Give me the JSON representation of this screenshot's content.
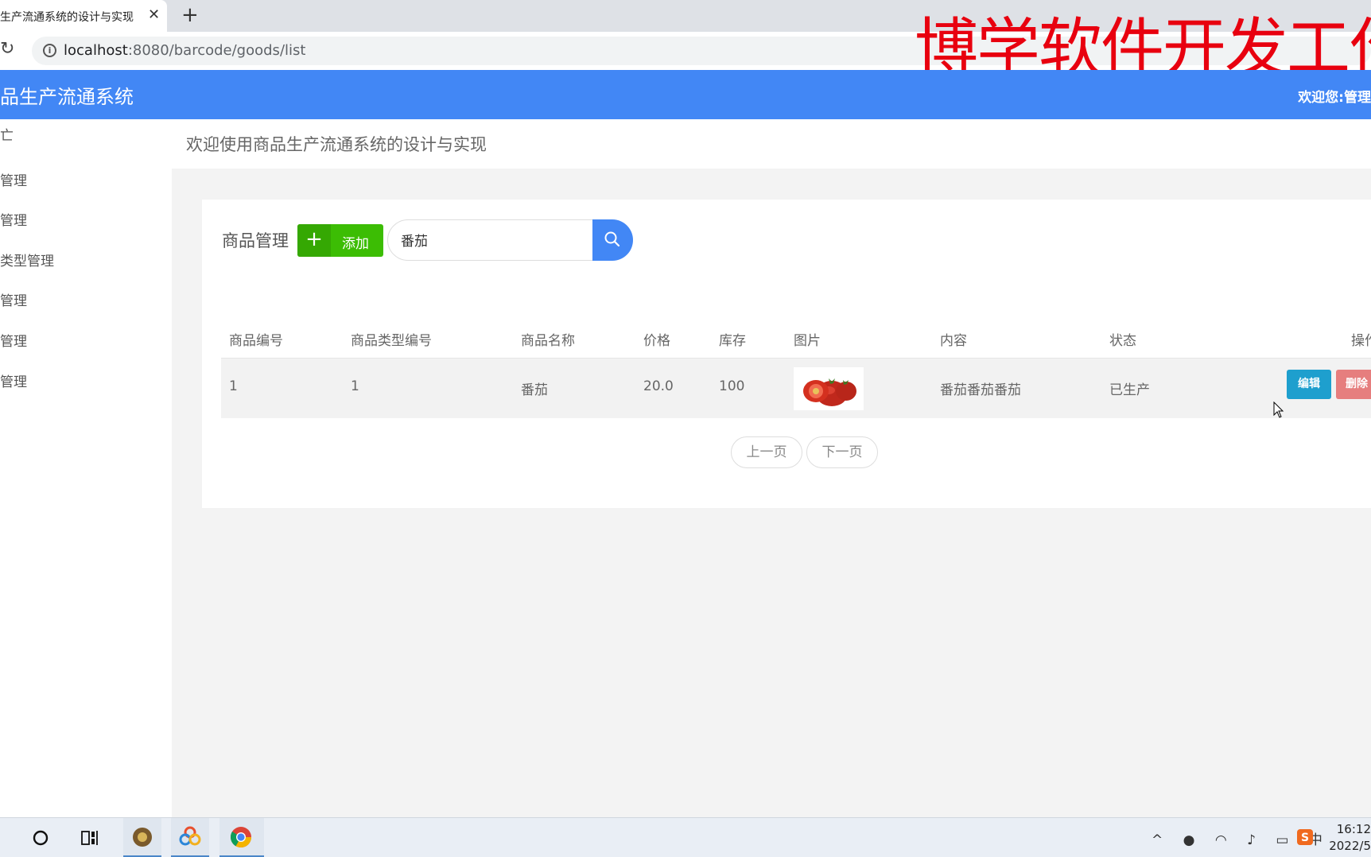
{
  "browser": {
    "tab_title": "生产流通系统的设计与实现",
    "tab_close": "✕",
    "new_tab": "+",
    "url_host": "localhost",
    "url_path": ":8080/barcode/goods/list"
  },
  "watermark": "博学软件开发工作",
  "header": {
    "app_title": "品生产流通系统",
    "welcome": "欢迎您:管理"
  },
  "sidebar": {
    "top_mark": "亡",
    "items": [
      {
        "label": "管理"
      },
      {
        "label": "管理"
      },
      {
        "label": "类型管理"
      },
      {
        "label": "管理"
      },
      {
        "label": "管理"
      },
      {
        "label": "管理"
      }
    ]
  },
  "welcome_bar": {
    "text": "欢迎使用商品生产流通系统的设计与实现"
  },
  "goods": {
    "title": "商品管理",
    "add_plus": "+",
    "add_label": "添加",
    "search_value": "番茄",
    "columns": [
      "商品编号",
      "商品类型编号",
      "商品名称",
      "价格",
      "库存",
      "图片",
      "内容",
      "状态",
      "操作"
    ],
    "rows": [
      {
        "id": "1",
        "type_id": "1",
        "name": "番茄",
        "price": "20.0",
        "stock": "100",
        "content": "番茄番茄番茄",
        "status": "已生产",
        "edit_label": "编辑",
        "delete_label": "删除"
      }
    ],
    "prev_page": "上一页",
    "next_page": "下一页"
  },
  "taskbar": {
    "time": "16:12",
    "date": "2022/5",
    "ime": "中"
  },
  "colors": {
    "accent": "#4287f5",
    "add_green": "#3cbd04",
    "edit_blue": "#1e9fce",
    "delete_red": "#e67e7e",
    "watermark_red": "#e8000f"
  }
}
